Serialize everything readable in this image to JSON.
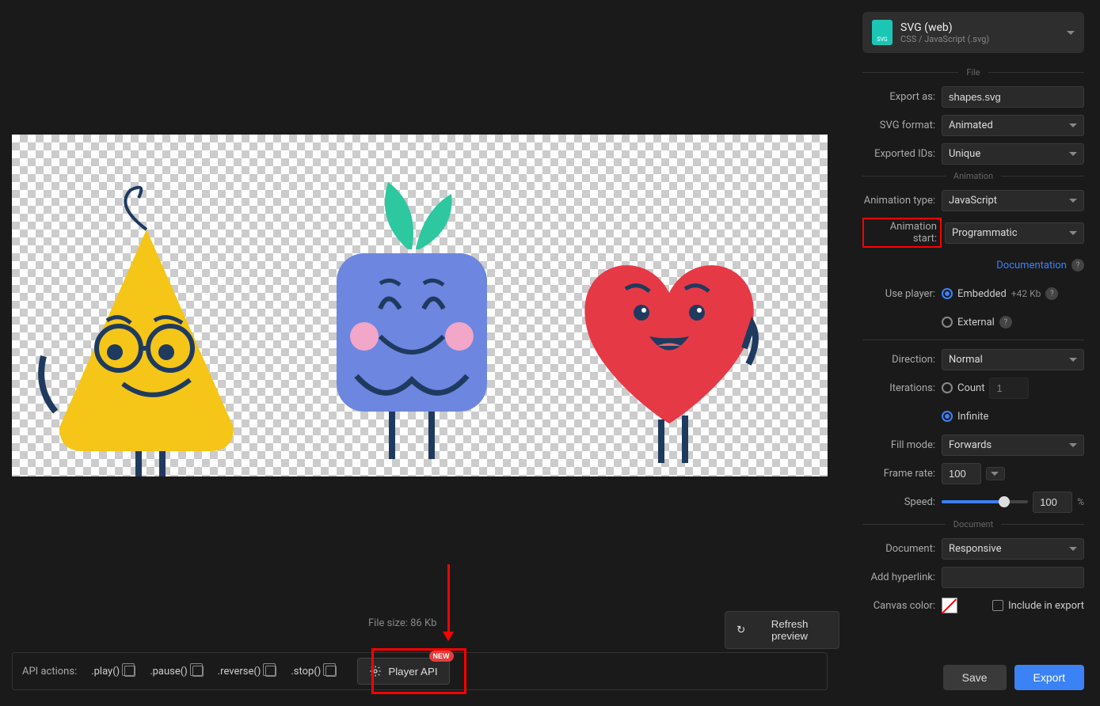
{
  "preview": {
    "file_size_label": "File size: 86 Kb",
    "refresh_label": "Refresh preview"
  },
  "api_bar": {
    "label": "API actions:",
    "actions": [
      ".play()",
      ".pause()",
      ".reverse()",
      ".stop()"
    ],
    "player_api_label": "Player API",
    "new_badge": "NEW"
  },
  "format": {
    "icon_text": "SVG",
    "title": "SVG (web)",
    "subtitle": "CSS / JavaScript (.svg)"
  },
  "sections": {
    "file": "File",
    "animation": "Animation",
    "document": "Document"
  },
  "file": {
    "export_as_label": "Export as:",
    "export_as_value": "shapes.svg",
    "svg_format_label": "SVG format:",
    "svg_format_value": "Animated",
    "exported_ids_label": "Exported IDs:",
    "exported_ids_value": "Unique"
  },
  "animation": {
    "type_label": "Animation type:",
    "type_value": "JavaScript",
    "start_label": "Animation start:",
    "start_value": "Programmatic",
    "documentation_label": "Documentation",
    "use_player_label": "Use player:",
    "embedded_label": "Embedded",
    "embedded_extra": "+42 Kb",
    "external_label": "External",
    "direction_label": "Direction:",
    "direction_value": "Normal",
    "iterations_label": "Iterations:",
    "count_label": "Count",
    "count_value": "1",
    "infinite_label": "Infinite",
    "fill_mode_label": "Fill mode:",
    "fill_mode_value": "Forwards",
    "frame_rate_label": "Frame rate:",
    "frame_rate_value": "100",
    "speed_label": "Speed:",
    "speed_value": "100",
    "speed_unit": "%"
  },
  "document": {
    "document_label": "Document:",
    "document_value": "Responsive",
    "hyperlink_label": "Add hyperlink:",
    "hyperlink_value": "",
    "canvas_color_label": "Canvas color:",
    "include_export_label": "Include in export"
  },
  "buttons": {
    "save": "Save",
    "export": "Export"
  }
}
